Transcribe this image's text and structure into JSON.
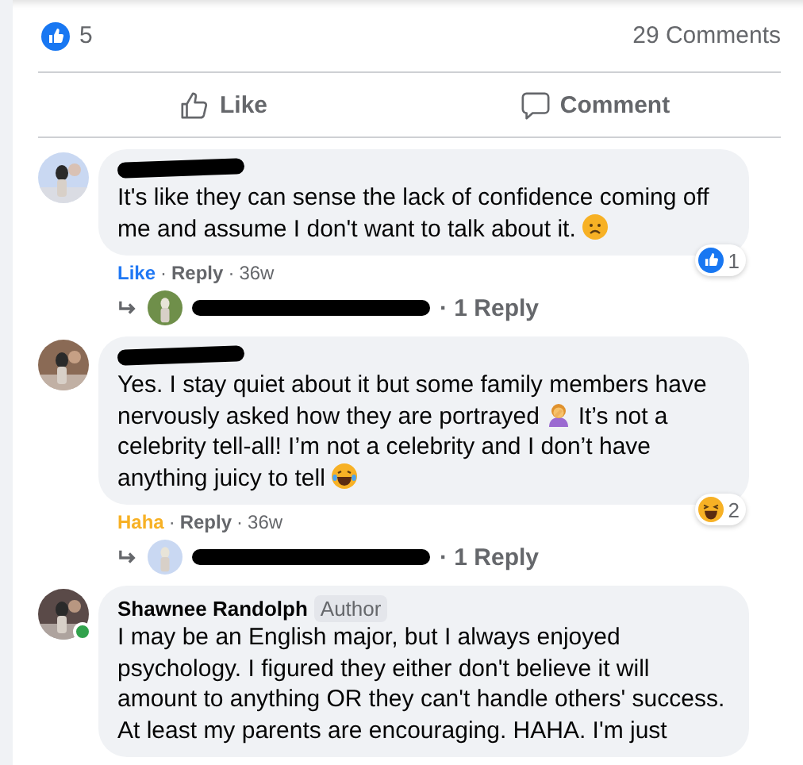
{
  "post": {
    "reactions_count": "5",
    "comments_count": "29 Comments"
  },
  "actions": [
    {
      "kind": "like",
      "label": "Like"
    },
    {
      "kind": "comment",
      "label": "Comment"
    }
  ],
  "comments": [
    {
      "author_redacted": true,
      "body": [
        {
          "kind": "text",
          "text": "It's like they can sense the lack of confidence coming off me and assume I don't want to talk about it. "
        },
        {
          "kind": "frown-emoji"
        }
      ],
      "badge": {
        "kind": "like",
        "count": "1"
      },
      "footer": {
        "reaction": "Like",
        "color": "#2078f4",
        "separator_1": "·",
        "reply": "Reply",
        "separator_2": "·",
        "time": "36w"
      },
      "replies": {
        "name_redacted": true,
        "label": "· 1 Reply"
      }
    },
    {
      "author_redacted": true,
      "body": [
        {
          "kind": "text",
          "text": "Yes. I stay quiet about it but some family members have nervously asked how they are portrayed "
        },
        {
          "kind": "facepalm-emoji"
        },
        {
          "kind": "text",
          "text": " It’s not a celebrity tell-all! I’m not a celebrity and I don’t have anything juicy to tell "
        },
        {
          "kind": "laugh-emoji"
        }
      ],
      "badge": {
        "kind": "haha",
        "count": "2"
      },
      "footer": {
        "reaction": "Haha",
        "color": "#f7b125",
        "separator_1": "·",
        "reply": "Reply",
        "separator_2": "·",
        "time": "36w"
      },
      "replies": {
        "name_redacted": true,
        "label": "· 1 Reply"
      }
    },
    {
      "author_redacted": false,
      "author": "Shawnee Randolph",
      "author_badge": "Author",
      "online": true,
      "body": [
        {
          "kind": "text",
          "text": "I may be an English major, but I always enjoyed psychology. I figured they either don't believe it will amount to anything OR they can't handle others' success. At least my parents are encouraging. HAHA. I'm just"
        }
      ]
    }
  ]
}
